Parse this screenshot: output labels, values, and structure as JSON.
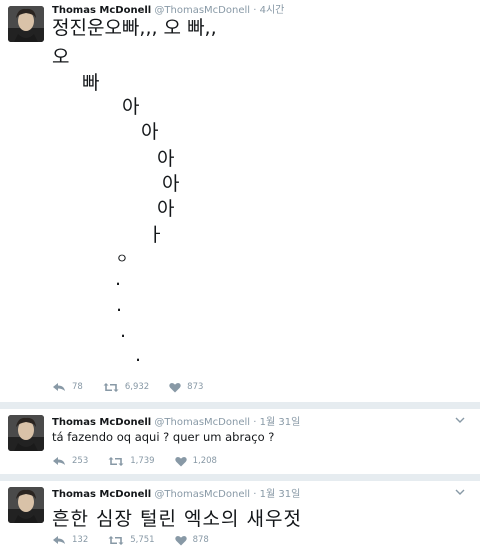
{
  "tweets": [
    {
      "author": "Thomas McDonell",
      "handle": "@ThomasMcDonell",
      "time": "4시간",
      "text_lines": [
        "정진운오빠,,, 오 빠,,",
        "오",
        "빠",
        "아",
        "아",
        "아",
        "아",
        "아",
        "ㅏ",
        "ㅇ",
        ".",
        ".",
        ".",
        "."
      ],
      "reply_count": "78",
      "retweet_count": "6,932",
      "like_count": "873"
    },
    {
      "author": "Thomas McDonell",
      "handle": "@ThomasMcDonell",
      "time": "1월 31일",
      "text": "tá fazendo oq aqui ? quer um abraço ?",
      "reply_count": "253",
      "retweet_count": "1,739",
      "like_count": "1,208"
    },
    {
      "author": "Thomas McDonell",
      "handle": "@ThomasMcDonell",
      "time": "1월 31일",
      "text": "흔한 심장 털린 엑소의 새우젓",
      "reply_count": "132",
      "retweet_count": "5,751",
      "like_count": "878"
    }
  ],
  "icons": {
    "reply": "reply-icon",
    "retweet": "retweet-icon",
    "like": "heart-icon",
    "menu": "chevron-down-icon"
  },
  "colors": {
    "meta": "#8899a6",
    "separator": "#e6ecf0",
    "text": "#14171a"
  }
}
